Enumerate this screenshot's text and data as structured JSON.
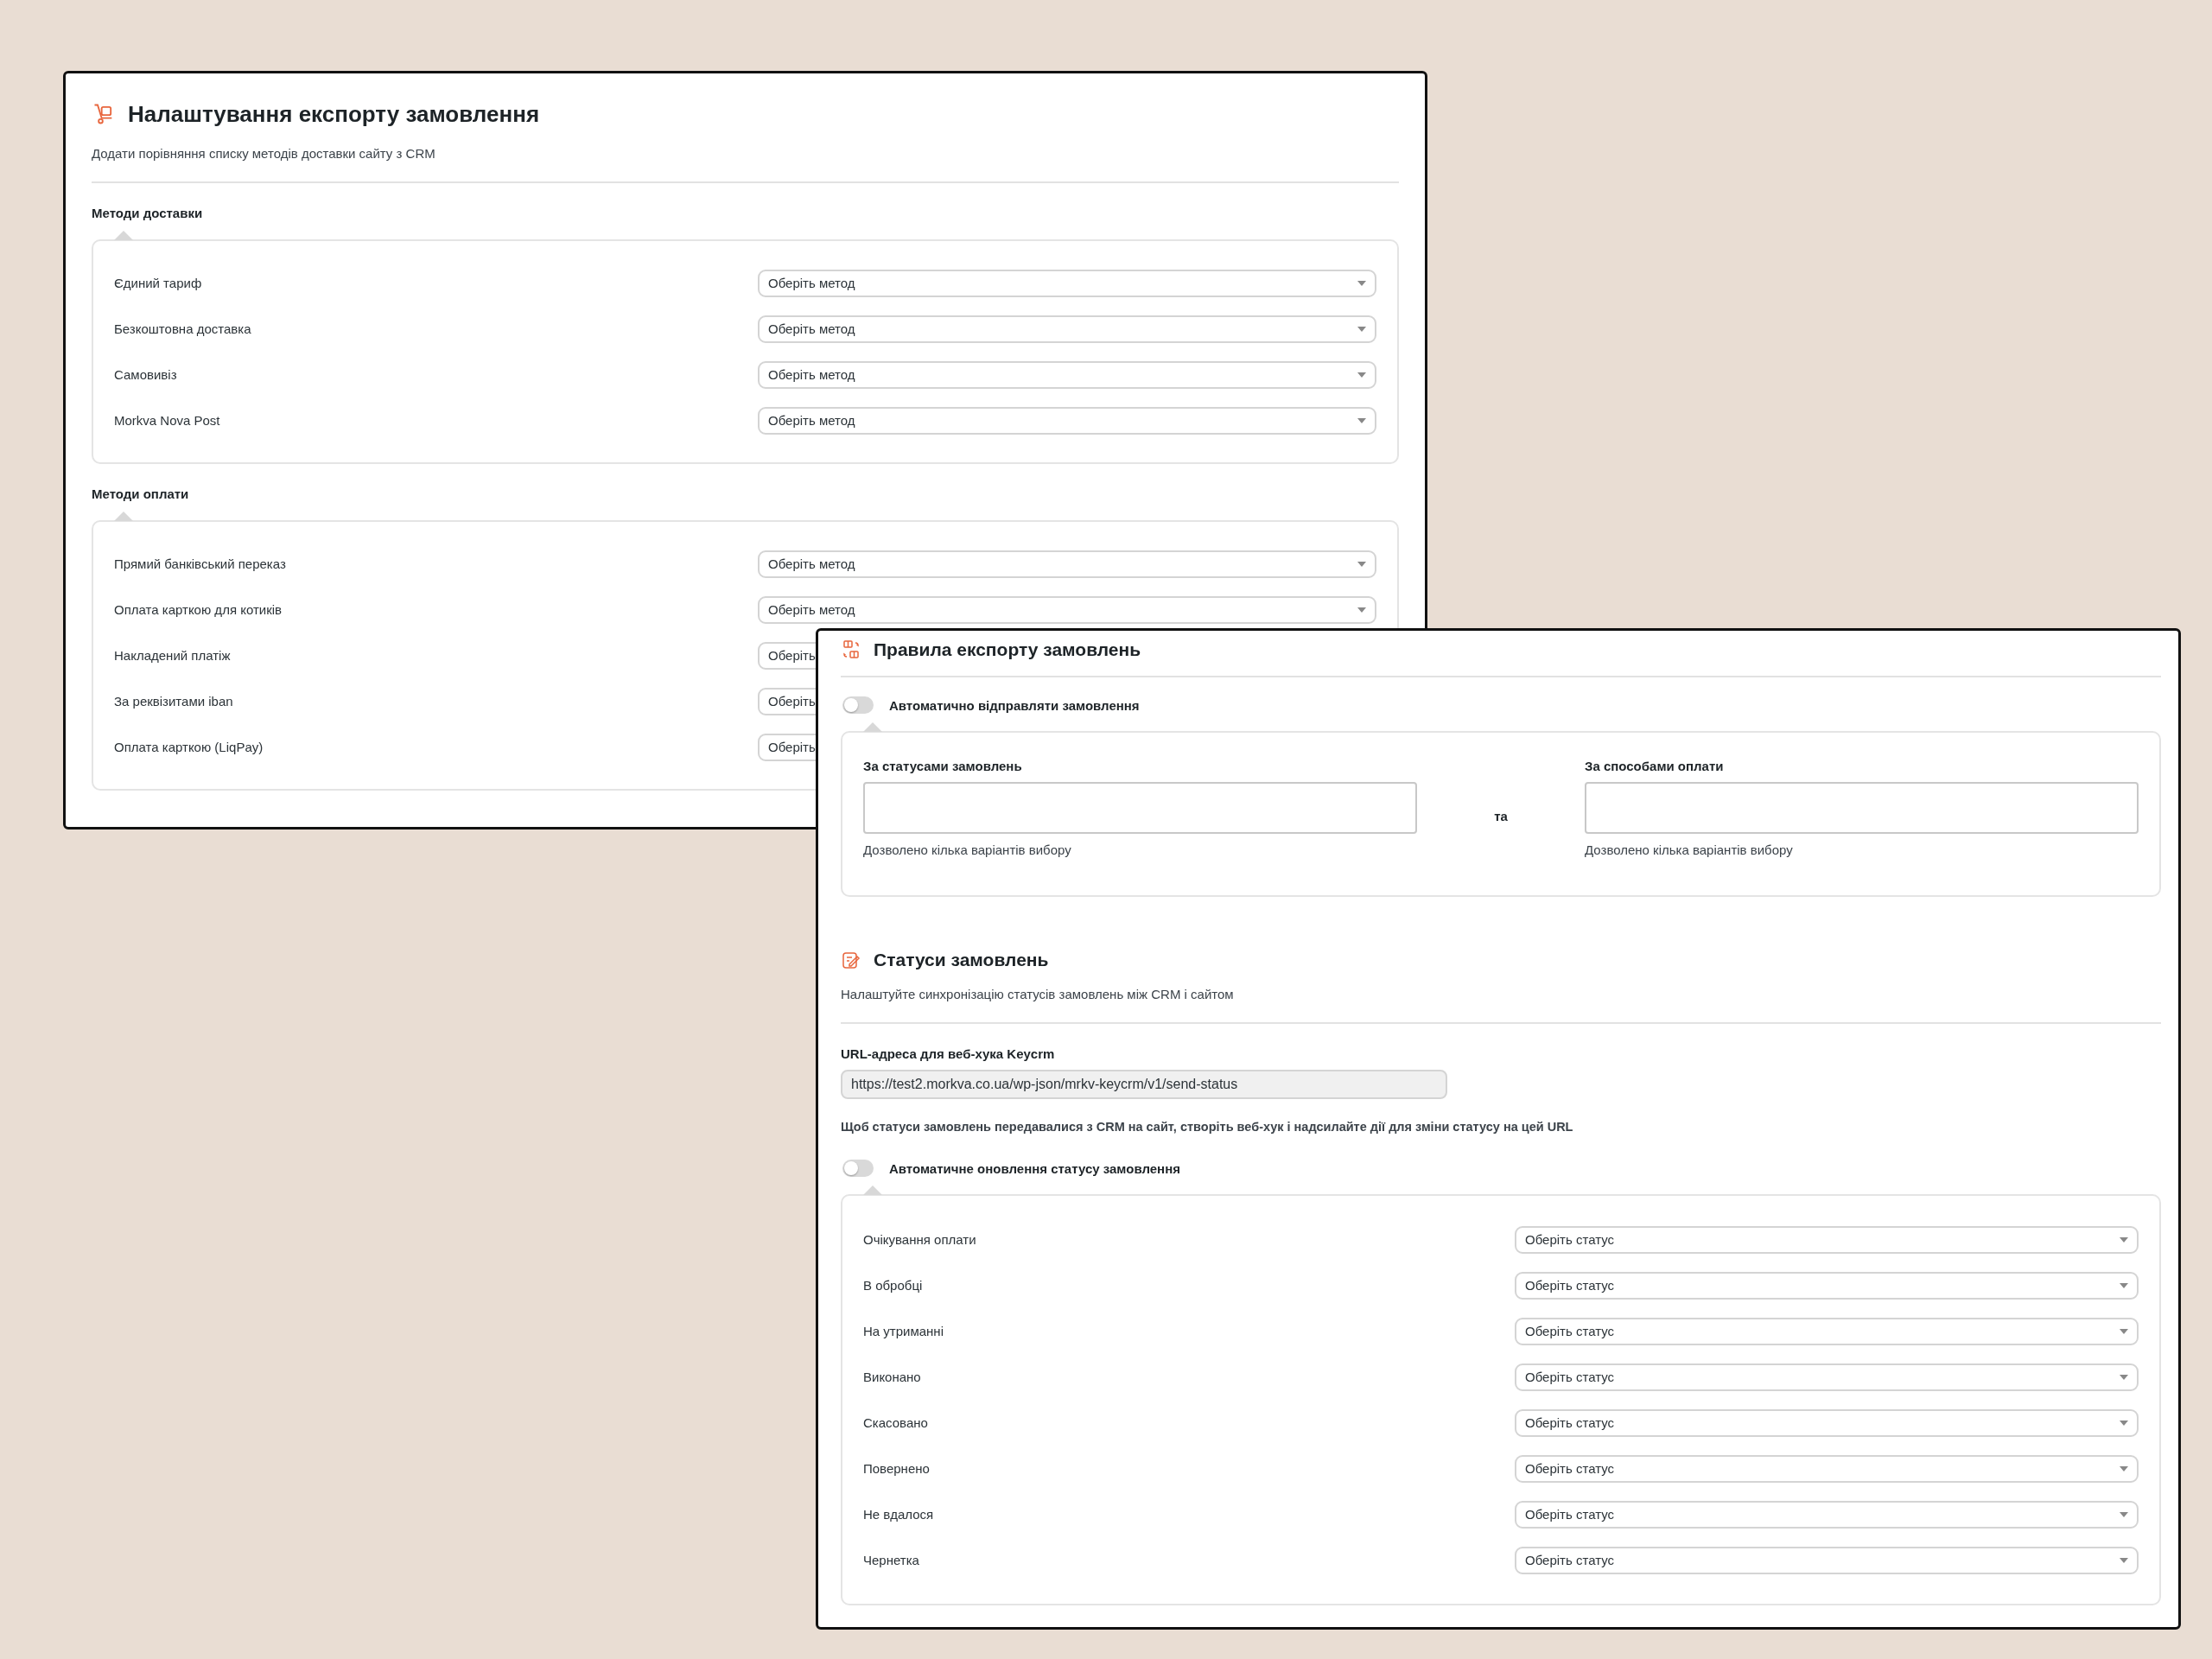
{
  "export_settings": {
    "title": "Налаштування експорту замовлення",
    "subtitle": "Додати порівняння списку методів доставки сайту з CRM",
    "sections": [
      {
        "heading": "Методи доставки",
        "rows": [
          {
            "label": "Єдиний тариф",
            "select": "Оберіть метод"
          },
          {
            "label": "Безкоштовна доставка",
            "select": "Оберіть метод"
          },
          {
            "label": "Самовивіз",
            "select": "Оберіть метод"
          },
          {
            "label": "Morkva Nova Post",
            "select": "Оберіть метод"
          }
        ]
      },
      {
        "heading": "Методи оплати",
        "rows": [
          {
            "label": "Прямий банківський переказ",
            "select": "Оберіть метод"
          },
          {
            "label": "Оплата карткою для котиків",
            "select": "Оберіть метод"
          },
          {
            "label": "Накладений платіж",
            "select": "Оберіть"
          },
          {
            "label": "За реквізитами iban",
            "select": "Оберіть"
          },
          {
            "label": "Оплата карткою (LiqPay)",
            "select": "Оберіть"
          }
        ]
      }
    ]
  },
  "export_rules": {
    "title": "Правила експорту замовлень",
    "toggle": {
      "label": "Автоматично відправляти замовлення",
      "on": false
    },
    "filters": [
      {
        "heading": "За статусами замовлень",
        "hint": "Дозволено кілька варіантів вибору"
      },
      {
        "heading": "За способами оплати",
        "hint": "Дозволено кілька варіантів вибору"
      }
    ],
    "connector": "та"
  },
  "order_statuses": {
    "title": "Статуси замовлень",
    "subtitle": "Налаштуйте синхронізацію статусів замовлень між CRM і сайтом",
    "webhook": {
      "label": "URL-адреса для веб-хука Keycrm",
      "value": "https://test2.morkva.co.ua/wp-json/mrkv-keycrm/v1/send-status",
      "help": "Щоб статуси замовлень передавалися з CRM на сайт, створіть веб-хук і надсилайте дії для зміни статусу на цей URL"
    },
    "toggle": {
      "label": "Автоматичне оновлення статусу замовлення",
      "on": false
    },
    "rows": [
      {
        "label": "Очікування оплати",
        "select": "Оберіть статус"
      },
      {
        "label": "В обробці",
        "select": "Оберіть статус"
      },
      {
        "label": "На утриманні",
        "select": "Оберіть статус"
      },
      {
        "label": "Виконано",
        "select": "Оберіть статус"
      },
      {
        "label": "Скасовано",
        "select": "Оберіть статус"
      },
      {
        "label": "Повернено",
        "select": "Оберіть статус"
      },
      {
        "label": "Не вдалося",
        "select": "Оберіть статус"
      },
      {
        "label": "Чернетка",
        "select": "Оберіть статус"
      }
    ]
  }
}
